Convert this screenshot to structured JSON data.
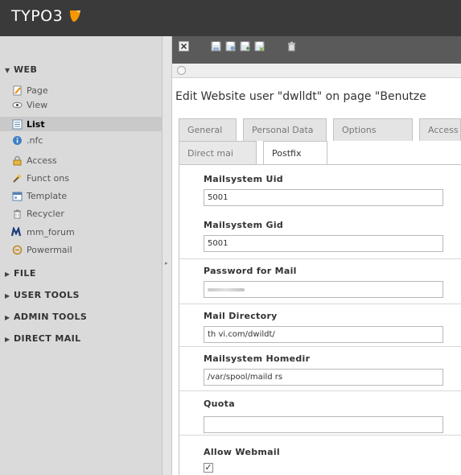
{
  "app": {
    "logo_text": "TYPO3",
    "brand_color": "#f49700"
  },
  "sidebar": {
    "web": {
      "header": "WEB",
      "items": [
        {
          "label": "Page",
          "icon": "page-icon"
        },
        {
          "label": "View",
          "icon": "eye-icon"
        },
        {
          "label": "List",
          "icon": "list-icon",
          "active": true
        },
        {
          "label": ".nfc",
          "icon": "info-icon"
        },
        {
          "label": "Access",
          "icon": "lock-icon"
        },
        {
          "label": "Funct ons",
          "icon": "wand-icon"
        },
        {
          "label": "Template",
          "icon": "template-icon"
        },
        {
          "label": "Recycler",
          "icon": "trash-icon"
        },
        {
          "label": "mm_forum",
          "icon": "forum-icon"
        },
        {
          "label": "Powermail",
          "icon": "mail-icon"
        }
      ]
    },
    "sections": [
      "FILE",
      "USER TOOLS",
      "ADMIN TOOLS",
      "DIRECT MAIL"
    ]
  },
  "toolbar": {
    "buttons": [
      "close-icon",
      "save-icon",
      "save-view-icon",
      "save-new-icon",
      "save-close-icon",
      "delete-icon"
    ]
  },
  "main": {
    "title": "Edit Website user \"dwlldt\" on page \"Benutze",
    "tabs_row1": [
      "General",
      "Personal Data",
      "Options",
      "Access"
    ],
    "tabs_row2": [
      "Direct mai",
      "Postfix"
    ],
    "active_tab": "Postfix",
    "fields": {
      "mailsystem_uid": {
        "label": "Mailsystem Uid",
        "value": "5001"
      },
      "mailsystem_gid": {
        "label": "Mailsystem Gid",
        "value": "5001"
      },
      "password": {
        "label": "Password for Mail",
        "value": ""
      },
      "mail_directory": {
        "label": "Mail Directory",
        "value": "th vi.com/dwildt/"
      },
      "homedir": {
        "label": "Mailsystem Homedir",
        "value": "/var/spool/maild rs"
      },
      "quota": {
        "label": "Quota",
        "value": ""
      },
      "allow_webmail": {
        "label": "Allow Webmail",
        "checked": true
      }
    }
  }
}
